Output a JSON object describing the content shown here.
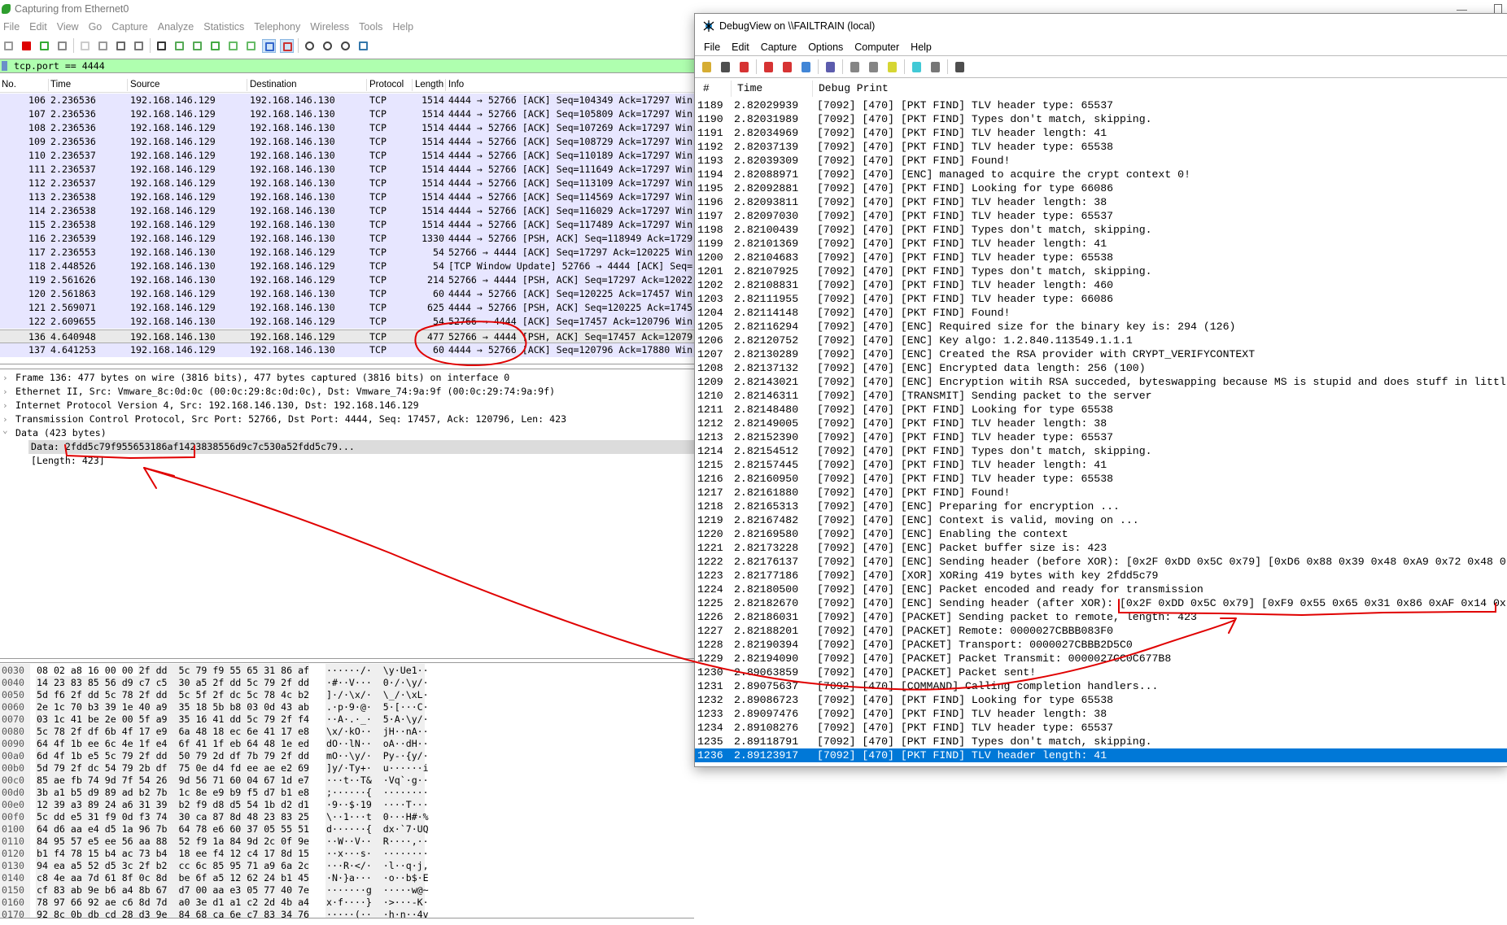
{
  "wireshark": {
    "title": "Capturing from Ethernet0",
    "menu": [
      "File",
      "Edit",
      "View",
      "Go",
      "Capture",
      "Analyze",
      "Statistics",
      "Telephony",
      "Wireless",
      "Tools",
      "Help"
    ],
    "toolbar_icons": [
      "start-capture-icon",
      "stop-capture-icon",
      "restart-capture-icon",
      "capture-options-icon",
      "open-file-icon",
      "save-file-icon",
      "close-file-icon",
      "reload-icon",
      "find-packet-icon",
      "go-back-icon",
      "go-forward-icon",
      "go-to-packet-icon",
      "go-first-icon",
      "go-last-icon",
      "autoscroll-icon",
      "colorize-icon",
      "zoom-in-icon",
      "zoom-out-icon",
      "normal-size-icon",
      "resize-columns-icon"
    ],
    "filter": "tcp.port == 4444",
    "columns": [
      "No.",
      "Time",
      "Source",
      "Destination",
      "Protocol",
      "Length",
      "Info"
    ],
    "packets": [
      [
        "106",
        "2.236536",
        "192.168.146.129",
        "192.168.146.130",
        "TCP",
        "1514",
        "4444 → 52766 [ACK] Seq=104349 Ack=17297 Win"
      ],
      [
        "107",
        "2.236536",
        "192.168.146.129",
        "192.168.146.130",
        "TCP",
        "1514",
        "4444 → 52766 [ACK] Seq=105809 Ack=17297 Win"
      ],
      [
        "108",
        "2.236536",
        "192.168.146.129",
        "192.168.146.130",
        "TCP",
        "1514",
        "4444 → 52766 [ACK] Seq=107269 Ack=17297 Win"
      ],
      [
        "109",
        "2.236536",
        "192.168.146.129",
        "192.168.146.130",
        "TCP",
        "1514",
        "4444 → 52766 [ACK] Seq=108729 Ack=17297 Win"
      ],
      [
        "110",
        "2.236537",
        "192.168.146.129",
        "192.168.146.130",
        "TCP",
        "1514",
        "4444 → 52766 [ACK] Seq=110189 Ack=17297 Win"
      ],
      [
        "111",
        "2.236537",
        "192.168.146.129",
        "192.168.146.130",
        "TCP",
        "1514",
        "4444 → 52766 [ACK] Seq=111649 Ack=17297 Win"
      ],
      [
        "112",
        "2.236537",
        "192.168.146.129",
        "192.168.146.130",
        "TCP",
        "1514",
        "4444 → 52766 [ACK] Seq=113109 Ack=17297 Win"
      ],
      [
        "113",
        "2.236538",
        "192.168.146.129",
        "192.168.146.130",
        "TCP",
        "1514",
        "4444 → 52766 [ACK] Seq=114569 Ack=17297 Win"
      ],
      [
        "114",
        "2.236538",
        "192.168.146.129",
        "192.168.146.130",
        "TCP",
        "1514",
        "4444 → 52766 [ACK] Seq=116029 Ack=17297 Win"
      ],
      [
        "115",
        "2.236538",
        "192.168.146.129",
        "192.168.146.130",
        "TCP",
        "1514",
        "4444 → 52766 [ACK] Seq=117489 Ack=17297 Win"
      ],
      [
        "116",
        "2.236539",
        "192.168.146.129",
        "192.168.146.130",
        "TCP",
        "1330",
        "4444 → 52766 [PSH, ACK] Seq=118949 Ack=1729"
      ],
      [
        "117",
        "2.236553",
        "192.168.146.130",
        "192.168.146.129",
        "TCP",
        "54",
        "52766 → 4444 [ACK] Seq=17297 Ack=120225 Win"
      ],
      [
        "118",
        "2.448526",
        "192.168.146.130",
        "192.168.146.129",
        "TCP",
        "54",
        "[TCP Window Update] 52766 → 4444 [ACK] Seq="
      ],
      [
        "119",
        "2.561626",
        "192.168.146.130",
        "192.168.146.129",
        "TCP",
        "214",
        "52766 → 4444 [PSH, ACK] Seq=17297 Ack=12022"
      ],
      [
        "120",
        "2.561863",
        "192.168.146.129",
        "192.168.146.130",
        "TCP",
        "60",
        "4444 → 52766 [ACK] Seq=120225 Ack=17457 Win"
      ],
      [
        "121",
        "2.569071",
        "192.168.146.129",
        "192.168.146.130",
        "TCP",
        "625",
        "4444 → 52766 [PSH, ACK] Seq=120225 Ack=1745"
      ],
      [
        "122",
        "2.609655",
        "192.168.146.130",
        "192.168.146.129",
        "TCP",
        "54",
        "52766 → 4444 [ACK] Seq=17457 Ack=120796 Win"
      ],
      [
        "136",
        "4.640948",
        "192.168.146.130",
        "192.168.146.129",
        "TCP",
        "477",
        "52766 → 4444 [PSH, ACK] Seq=17457 Ack=12079"
      ],
      [
        "137",
        "4.641253",
        "192.168.146.129",
        "192.168.146.130",
        "TCP",
        "60",
        "4444 → 52766 [ACK] Seq=120796 Ack=17880 Win"
      ]
    ],
    "selected_packet": "136",
    "details": [
      {
        "text": "Frame 136: 477 bytes on wire (3816 bits), 477 bytes captured (3816 bits) on interface 0",
        "expanded": false
      },
      {
        "text": "Ethernet II, Src: Vmware_8c:0d:0c (00:0c:29:8c:0d:0c), Dst: Vmware_74:9a:9f (00:0c:29:74:9a:9f)",
        "expanded": false
      },
      {
        "text": "Internet Protocol Version 4, Src: 192.168.146.130, Dst: 192.168.146.129",
        "expanded": false
      },
      {
        "text": "Transmission Control Protocol, Src Port: 52766, Dst Port: 4444, Seq: 17457, Ack: 120796, Len: 423",
        "expanded": false
      },
      {
        "text": "Data (423 bytes)",
        "expanded": true
      }
    ],
    "data_field": "Data: 2fdd5c79f955653186af1423838556d9c7c530a52fdd5c79...",
    "data_length": "[Length: 423]",
    "hex": [
      [
        "0030",
        "08 02 a8 16 00 00 2f dd  5c 79 f9 55 65 31 86 af",
        "······/·  \\y·Ue1··"
      ],
      [
        "0040",
        "14 23 83 85 56 d9 c7 c5  30 a5 2f dd 5c 79 2f dd",
        "·#··V···  0·/·\\y/·"
      ],
      [
        "0050",
        "5d f6 2f dd 5c 78 2f dd  5c 5f 2f dc 5c 78 4c b2",
        "]·/·\\x/·  \\_/·\\xL·"
      ],
      [
        "0060",
        "2e 1c 70 b3 39 1e 40 a9  35 18 5b b8 03 0d 43 ab",
        ".·p·9·@·  5·[···C·"
      ],
      [
        "0070",
        "03 1c 41 be 2e 00 5f a9  35 16 41 dd 5c 79 2f f4",
        "··A·.·_·  5·A·\\y/·"
      ],
      [
        "0080",
        "5c 78 2f df 6b 4f 17 e9  6a 48 18 ec 6e 41 17 e8",
        "\\x/·kO··  jH··nA··"
      ],
      [
        "0090",
        "64 4f 1b ee 6c 4e 1f e4  6f 41 1f eb 64 48 1e ed",
        "dO··lN··  oA··dH··"
      ],
      [
        "00a0",
        "6d 4f 1b e5 5c 79 2f dd  50 79 2d df 7b 79 2f dd",
        "mO··\\y/·  Py-·{y/·"
      ],
      [
        "00b0",
        "5d 79 2f dc 54 79 2b df  75 0e d4 fd ee ae e2 69",
        "]y/·Ty+·  u······i"
      ],
      [
        "00c0",
        "85 ae fb 74 9d 7f 54 26  9d 56 71 60 04 67 1d e7",
        "···t··T&  ·Vq`·g··"
      ],
      [
        "00d0",
        "3b a1 b5 d9 89 ad b2 7b  1c 8e e9 b9 f5 d7 b1 e8",
        ";······{  ········"
      ],
      [
        "00e0",
        "12 39 a3 89 24 a6 31 39  b2 f9 d8 d5 54 1b d2 d1",
        "·9··$·19  ····T···"
      ],
      [
        "00f0",
        "5c dd e5 31 f9 0d f3 74  30 ca 87 8d 48 23 83 25",
        "\\··1···t  0···H#·%"
      ],
      [
        "0100",
        "64 d6 aa e4 d5 1a 96 7b  64 78 e6 60 37 05 55 51",
        "d······{  dx·`7·UQ"
      ],
      [
        "0110",
        "84 95 57 e5 ee 56 aa 88  52 f9 1a 84 9d 2c 0f 9e",
        "··W··V··  R····,··"
      ],
      [
        "0120",
        "b1 f4 78 15 b4 ac 73 b4  18 ee f4 12 c4 17 8d 15",
        "··x···s·  ········"
      ],
      [
        "0130",
        "94 ea a5 52 d5 3c 2f b2  cc 6c 85 95 71 a9 6a 2c",
        "···R·</·  ·l··q·j,"
      ],
      [
        "0140",
        "c8 4e aa 7d 61 8f 0c 8d  be 6f a5 12 62 24 b1 45",
        "·N·}a···  ·o··b$·E"
      ],
      [
        "0150",
        "cf 83 ab 9e b6 a4 8b 67  d7 00 aa e3 05 77 40 7e",
        "·······g  ·····w@~"
      ],
      [
        "0160",
        "78 97 66 92 ae c6 8d 7d  a0 3e d1 a1 c2 2d 4b a4",
        "x·f····}  ·>···-K·"
      ],
      [
        "0170",
        "92 8c 0b db cd 28 d3 9e  84 68 ca 6e c7 83 34 76",
        "·····(··  ·h·n··4v"
      ]
    ]
  },
  "debugview": {
    "title": "DebugView on \\\\FAILTRAIN (local)",
    "menu": [
      "File",
      "Edit",
      "Capture",
      "Options",
      "Computer",
      "Help"
    ],
    "toolbar_icons": [
      "open-icon",
      "save-icon",
      "clear-save-icon",
      "capture-icon",
      "capture-kernel-icon",
      "pass-through-icon",
      "clear-display-icon",
      "time-format-icon",
      "autoscroll-icon",
      "clock-icon",
      "filter-icon",
      "highlight-icon",
      "find-icon"
    ],
    "columns": [
      "#",
      "Time",
      "Debug Print"
    ],
    "rows": [
      [
        "1189",
        "2.82029939",
        "[7092] [470] [PKT FIND] TLV header type: 65537"
      ],
      [
        "1190",
        "2.82031989",
        "[7092] [470] [PKT FIND] Types don't match, skipping."
      ],
      [
        "1191",
        "2.82034969",
        "[7092] [470] [PKT FIND] TLV header length: 41"
      ],
      [
        "1192",
        "2.82037139",
        "[7092] [470] [PKT FIND] TLV header type: 65538"
      ],
      [
        "1193",
        "2.82039309",
        "[7092] [470] [PKT FIND] Found!"
      ],
      [
        "1194",
        "2.82088971",
        "[7092] [470] [ENC] managed to acquire the crypt context 0!"
      ],
      [
        "1195",
        "2.82092881",
        "[7092] [470] [PKT FIND] Looking for type 66086"
      ],
      [
        "1196",
        "2.82093811",
        "[7092] [470] [PKT FIND] TLV header length: 38"
      ],
      [
        "1197",
        "2.82097030",
        "[7092] [470] [PKT FIND] TLV header type: 65537"
      ],
      [
        "1198",
        "2.82100439",
        "[7092] [470] [PKT FIND] Types don't match, skipping."
      ],
      [
        "1199",
        "2.82101369",
        "[7092] [470] [PKT FIND] TLV header length: 41"
      ],
      [
        "1200",
        "2.82104683",
        "[7092] [470] [PKT FIND] TLV header type: 65538"
      ],
      [
        "1201",
        "2.82107925",
        "[7092] [470] [PKT FIND] Types don't match, skipping."
      ],
      [
        "1202",
        "2.82108831",
        "[7092] [470] [PKT FIND] TLV header length: 460"
      ],
      [
        "1203",
        "2.82111955",
        "[7092] [470] [PKT FIND] TLV header type: 66086"
      ],
      [
        "1204",
        "2.82114148",
        "[7092] [470] [PKT FIND] Found!"
      ],
      [
        "1205",
        "2.82116294",
        "[7092] [470] [ENC] Required size for the binary key is: 294 (126)"
      ],
      [
        "1206",
        "2.82120752",
        "[7092] [470] [ENC] Key algo: 1.2.840.113549.1.1.1"
      ],
      [
        "1207",
        "2.82130289",
        "[7092] [470] [ENC] Created the RSA provider with CRYPT_VERIFYCONTEXT"
      ],
      [
        "1208",
        "2.82137132",
        "[7092] [470] [ENC] Encrypted data length: 256 (100)"
      ],
      [
        "1209",
        "2.82143021",
        "[7092] [470] [ENC] Encryption witih RSA succeded, byteswapping because MS is stupid and does stuff in littl"
      ],
      [
        "1210",
        "2.82146311",
        "[7092] [470] [TRANSMIT] Sending packet to the server"
      ],
      [
        "1211",
        "2.82148480",
        "[7092] [470] [PKT FIND] Looking for type 65538"
      ],
      [
        "1212",
        "2.82149005",
        "[7092] [470] [PKT FIND] TLV header length: 38"
      ],
      [
        "1213",
        "2.82152390",
        "[7092] [470] [PKT FIND] TLV header type: 65537"
      ],
      [
        "1214",
        "2.82154512",
        "[7092] [470] [PKT FIND] Types don't match, skipping."
      ],
      [
        "1215",
        "2.82157445",
        "[7092] [470] [PKT FIND] TLV header length: 41"
      ],
      [
        "1216",
        "2.82160950",
        "[7092] [470] [PKT FIND] TLV header type: 65538"
      ],
      [
        "1217",
        "2.82161880",
        "[7092] [470] [PKT FIND] Found!"
      ],
      [
        "1218",
        "2.82165313",
        "[7092] [470] [ENC] Preparing for encryption ..."
      ],
      [
        "1219",
        "2.82167482",
        "[7092] [470] [ENC] Context is valid, moving on ..."
      ],
      [
        "1220",
        "2.82169580",
        "[7092] [470] [ENC] Enabling the context"
      ],
      [
        "1221",
        "2.82173228",
        "[7092] [470] [ENC] Packet buffer size is: 423"
      ],
      [
        "1222",
        "2.82176137",
        "[7092] [470] [ENC] Sending header (before XOR): [0x2F 0xDD 0x5C 0x79] [0xD6 0x88 0x39 0x48 0xA9 0x72 0x48 0"
      ],
      [
        "1223",
        "2.82177186",
        "[7092] [470] [XOR] XORing 419 bytes with key 2fdd5c79"
      ],
      [
        "1224",
        "2.82180500",
        "[7092] [470] [ENC] Packet encoded and ready for transmission"
      ],
      [
        "1225",
        "2.82182670",
        "[7092] [470] [ENC] Sending header (after XOR): [0x2F 0xDD 0x5C 0x79] [0xF9 0x55 0x65 0x31 0x86 0xAF 0x14 0x"
      ],
      [
        "1226",
        "2.82186031",
        "[7092] [470] [PACKET] Sending packet to remote, length: 423"
      ],
      [
        "1227",
        "2.82188201",
        "[7092] [470] [PACKET] Remote: 0000027CBBB083F0"
      ],
      [
        "1228",
        "2.82190394",
        "[7092] [470] [PACKET] Transport: 0000027CBBB2D5C0"
      ],
      [
        "1229",
        "2.82194090",
        "[7092] [470] [PACKET] Packet Transmit: 0000027CC0C677B8"
      ],
      [
        "1230",
        "2.89063859",
        "[7092] [470] [PACKET] Packet sent!"
      ],
      [
        "1231",
        "2.89075637",
        "[7092] [470] [COMMAND] Calling completion handlers..."
      ],
      [
        "1232",
        "2.89086723",
        "[7092] [470] [PKT FIND] Looking for type 65538"
      ],
      [
        "1233",
        "2.89097476",
        "[7092] [470] [PKT FIND] TLV header length: 38"
      ],
      [
        "1234",
        "2.89108276",
        "[7092] [470] [PKT FIND] TLV header type: 65537"
      ],
      [
        "1235",
        "2.89118791",
        "[7092] [470] [PKT FIND] Types don't match, skipping."
      ],
      [
        "1236",
        "2.89123917",
        "[7092] [470] [PKT FIND] TLV header length: 41"
      ]
    ],
    "selected_row": "1236"
  },
  "colors": {
    "filter_ok": "#afffaf",
    "packet_row": "#e7e6ff",
    "selection": "#0078d7",
    "annotation": "#e00000"
  }
}
